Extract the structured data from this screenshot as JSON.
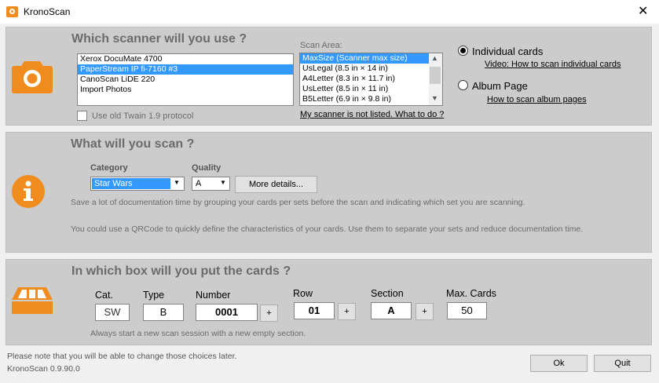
{
  "window": {
    "title": "KronoScan"
  },
  "scanner": {
    "heading": "Which scanner will you use ?",
    "scanners": [
      "Xerox DocuMate 4700",
      "PaperStream IP fi-7160 #3",
      "CanoScan LiDE 220",
      "Import Photos"
    ],
    "selected_scanner": 1,
    "old_twain_label": "Use old Twain 1.9 protocol",
    "scan_area_label": "Scan Area:",
    "scan_areas": [
      "MaxSize (Scanner max size)",
      "UsLegal (8.5 in × 14 in)",
      "A4Letter (8.3 in × 11.7 in)",
      "UsLetter (8.5 in × 11 in)",
      "B5Letter (6.9 in × 9.8 in)"
    ],
    "selected_area": 0,
    "not_listed_link": "My scanner is not listed. What to do ?",
    "individual_label": "Individual cards",
    "individual_video_link": "Video: How to scan individual cards",
    "album_label": "Album Page",
    "album_link": "How to scan album pages"
  },
  "scan": {
    "heading": "What will you scan ?",
    "category_label": "Category",
    "category_value": "Star Wars",
    "quality_label": "Quality",
    "quality_value": "A",
    "more_details": "More details...",
    "info1": "Save a lot of documentation time by grouping your cards per sets before the scan and indicating which set you are scanning.",
    "info2": "You could use a QRCode to quickly define the characteristics of your cards. Use them to separate your sets and reduce documentation time."
  },
  "box": {
    "heading": "In which box will you put the cards ?",
    "cat_label": "Cat.",
    "cat_value": "SW",
    "type_label": "Type",
    "type_value": "B",
    "number_label": "Number",
    "number_value": "0001",
    "row_label": "Row",
    "row_value": "01",
    "section_label": "Section",
    "section_value": "A",
    "max_label": "Max. Cards",
    "max_value": "50",
    "plus": "+",
    "note": "Always start a new scan session with a new empty section."
  },
  "footer": {
    "note": "Please note that you will be able to change those choices later.",
    "version": "KronoScan 0.9.90.0",
    "ok": "Ok",
    "quit": "Quit"
  },
  "colors": {
    "accent": "#f08c1e",
    "selection": "#3399ff",
    "panel": "#cccccc"
  }
}
